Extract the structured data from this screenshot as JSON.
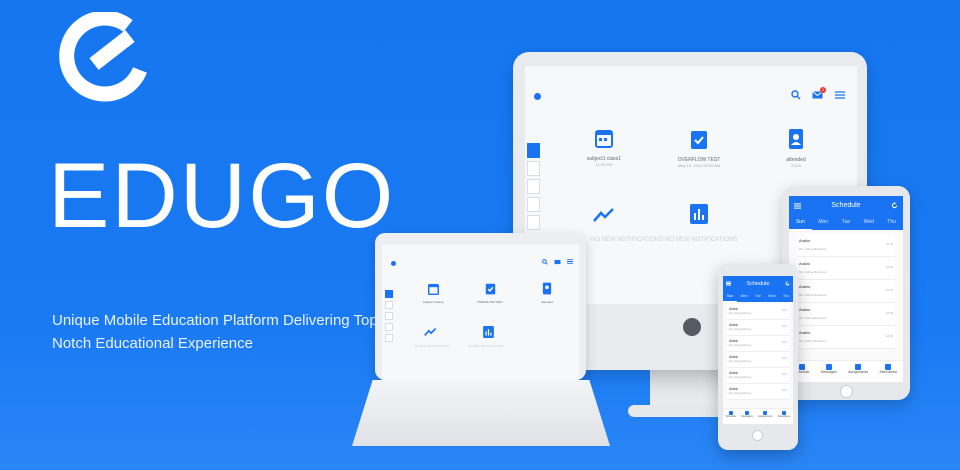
{
  "brand": {
    "name": "EDUGO",
    "tagline_line1": "Unique Mobile Education Platform Delivering Top",
    "tagline_line2": "Notch Educational Experience",
    "logo_icon": "edugo-logo"
  },
  "desktop": {
    "tiles": [
      {
        "icon": "calendar-icon",
        "caption": "subject1 class1",
        "sub": "11:00 PM"
      },
      {
        "icon": "clipboard-check-icon",
        "caption": "OVERFLOW TEST",
        "sub": "May 14, 2019 00:00 AM"
      },
      {
        "icon": "contact-badge-icon",
        "caption": "attended",
        "sub": "2/100"
      }
    ],
    "notifications": [
      {
        "icon": "trending-icon",
        "label": "NO NEW NOTIFICATIONS"
      },
      {
        "icon": "bar-chart-icon",
        "label": "NO NEW NOTIFICATIONS"
      }
    ],
    "header_icons": [
      "search-icon",
      "mail-icon",
      "menu-icon"
    ],
    "mail_badge": "1"
  },
  "schedule": {
    "title": "Schedule",
    "days_tablet": [
      "Sun",
      "Mon",
      "Tue",
      "Wed",
      "Thu"
    ],
    "days_phone": [
      "Sun",
      "Mon",
      "Tue",
      "Wed",
      "Thu"
    ],
    "entry_title": "Arabic",
    "entry_sub": "Mrs. Salma Mohamed",
    "entry_time": "10:00",
    "nav": [
      "Schedule",
      "Messages",
      "Assignments",
      "Attendance"
    ]
  },
  "colors": {
    "brand_blue": "#1a73f2",
    "background": "#1876f1",
    "device_gray": "#e9ebee"
  }
}
